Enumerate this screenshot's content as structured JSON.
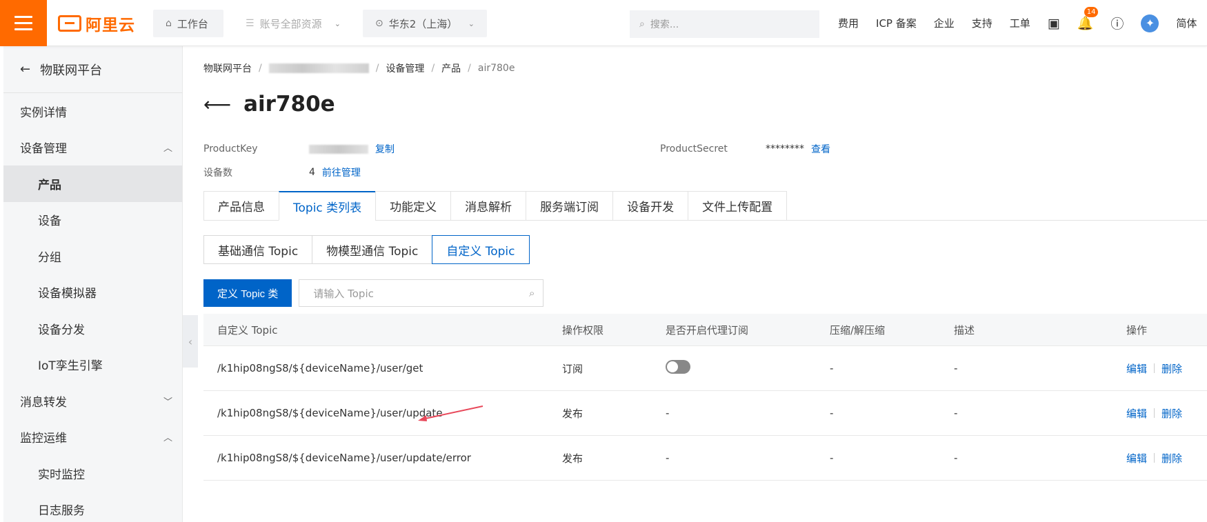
{
  "topbar": {
    "logo_text": "阿里云",
    "workbench": "工作台",
    "resources": "账号全部资源",
    "region": "华东2（上海）",
    "search_placeholder": "搜索...",
    "links": [
      "费用",
      "ICP 备案",
      "企业",
      "支持",
      "工单"
    ],
    "notification_count": "14",
    "language": "简体"
  },
  "sidebar": {
    "back_label": "物联网平台",
    "items": [
      {
        "label": "实例详情",
        "sub": false,
        "active": false
      },
      {
        "label": "设备管理",
        "sub": false,
        "active": false,
        "caret": "up"
      },
      {
        "label": "产品",
        "sub": true,
        "active": true
      },
      {
        "label": "设备",
        "sub": true,
        "active": false
      },
      {
        "label": "分组",
        "sub": true,
        "active": false
      },
      {
        "label": "设备模拟器",
        "sub": true,
        "active": false
      },
      {
        "label": "设备分发",
        "sub": true,
        "active": false
      },
      {
        "label": "IoT孪生引擎",
        "sub": true,
        "active": false
      },
      {
        "label": "消息转发",
        "sub": false,
        "active": false,
        "caret": "down"
      },
      {
        "label": "监控运维",
        "sub": false,
        "active": false,
        "caret": "up"
      },
      {
        "label": "实时监控",
        "sub": true,
        "active": false
      },
      {
        "label": "日志服务",
        "sub": true,
        "active": false
      }
    ]
  },
  "breadcrumb": {
    "root": "物联网平台",
    "device_mgmt": "设备管理",
    "product": "产品",
    "current": "air780e"
  },
  "page": {
    "title": "air780e",
    "product_key_label": "ProductKey",
    "copy_label": "复制",
    "product_secret_label": "ProductSecret",
    "product_secret_value": "********",
    "view_label": "查看",
    "device_count_label": "设备数",
    "device_count_value": "4",
    "manage_label": "前往管理"
  },
  "tabs": [
    "产品信息",
    "Topic 类列表",
    "功能定义",
    "消息解析",
    "服务端订阅",
    "设备开发",
    "文件上传配置"
  ],
  "subtabs": [
    "基础通信 Topic",
    "物模型通信 Topic",
    "自定义 Topic"
  ],
  "toolbar": {
    "define_button": "定义 Topic 类",
    "search_placeholder": "请输入 Topic"
  },
  "table": {
    "headers": [
      "自定义 Topic",
      "操作权限",
      "是否开启代理订阅",
      "压缩/解压缩",
      "描述",
      "操作"
    ],
    "edit_label": "编辑",
    "delete_label": "删除",
    "rows": [
      {
        "topic": "/k1hip08ngS8/${deviceName}/user/get",
        "permission": "订阅",
        "proxy": "toggle",
        "compress": "-",
        "desc": "-"
      },
      {
        "topic": "/k1hip08ngS8/${deviceName}/user/update",
        "permission": "发布",
        "proxy": "-",
        "compress": "-",
        "desc": "-"
      },
      {
        "topic": "/k1hip08ngS8/${deviceName}/user/update/error",
        "permission": "发布",
        "proxy": "-",
        "compress": "-",
        "desc": "-"
      }
    ]
  },
  "colors": {
    "brand_orange": "#ff6a00",
    "primary_blue": "#0064c8",
    "annotation_red": "#e8485a"
  }
}
